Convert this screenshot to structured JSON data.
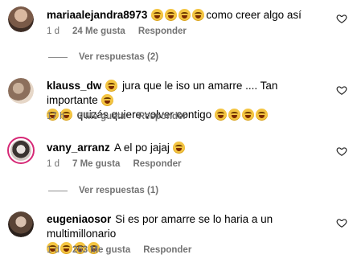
{
  "comments": [
    {
      "username": "mariaalejandra8973",
      "text_before": "",
      "text_after": "como creer algo así",
      "emoji_count_before": 4,
      "emoji_count_after": 0,
      "time": "1 d",
      "likes": "24 Me gusta",
      "reply": "Responder",
      "view_replies": "Ver respuestas (2)"
    },
    {
      "username": "klauss_dw",
      "line1": "jura que le iso un amarre .... Tan importante",
      "line2": "quizás quiere volver contigo",
      "time": "17 h",
      "likes": "3 Me gusta",
      "reply": "Responder"
    },
    {
      "username": "vany_arranz",
      "text": "A el po jajaj",
      "time": "1 d",
      "likes": "7 Me gusta",
      "reply": "Responder",
      "view_replies": "Ver respuestas (1)"
    },
    {
      "username": "eugeniaosor",
      "text": "Si es por amarre se lo haria a un multimillonario",
      "time": "1 d",
      "likes": "263 Me gusta",
      "reply": "Responder"
    }
  ],
  "icons": {
    "like": "heart-outline-icon",
    "emoji": "laughing-face-emoji"
  },
  "colors": {
    "meta": "#737373",
    "story_ring": "#d62976"
  }
}
